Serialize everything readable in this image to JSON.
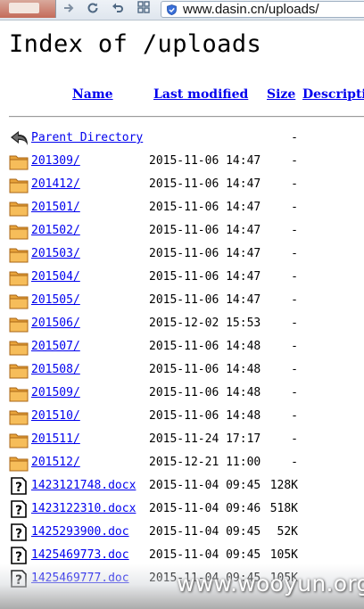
{
  "browser": {
    "url": "www.dasin.cn/uploads/",
    "icons": [
      "forward-icon",
      "refresh-icon",
      "undo-icon",
      "windows-icon",
      "security-shield-icon"
    ]
  },
  "page": {
    "title": "Index of /uploads",
    "columns": {
      "name": "Name",
      "last_modified": "Last modified",
      "size": "Size",
      "description": "Description"
    },
    "entries": [
      {
        "name": "Parent Directory",
        "date": "",
        "size": "-",
        "icon": "back-arrow-icon"
      },
      {
        "name": "201309/",
        "date": "2015-11-06 14:47",
        "size": "-",
        "icon": "folder-icon"
      },
      {
        "name": "201412/",
        "date": "2015-11-06 14:47",
        "size": "-",
        "icon": "folder-icon"
      },
      {
        "name": "201501/",
        "date": "2015-11-06 14:47",
        "size": "-",
        "icon": "folder-icon"
      },
      {
        "name": "201502/",
        "date": "2015-11-06 14:47",
        "size": "-",
        "icon": "folder-icon"
      },
      {
        "name": "201503/",
        "date": "2015-11-06 14:47",
        "size": "-",
        "icon": "folder-icon"
      },
      {
        "name": "201504/",
        "date": "2015-11-06 14:47",
        "size": "-",
        "icon": "folder-icon"
      },
      {
        "name": "201505/",
        "date": "2015-11-06 14:47",
        "size": "-",
        "icon": "folder-icon"
      },
      {
        "name": "201506/",
        "date": "2015-12-02 15:53",
        "size": "-",
        "icon": "folder-icon"
      },
      {
        "name": "201507/",
        "date": "2015-11-06 14:48",
        "size": "-",
        "icon": "folder-icon"
      },
      {
        "name": "201508/",
        "date": "2015-11-06 14:48",
        "size": "-",
        "icon": "folder-icon"
      },
      {
        "name": "201509/",
        "date": "2015-11-06 14:48",
        "size": "-",
        "icon": "folder-icon"
      },
      {
        "name": "201510/",
        "date": "2015-11-06 14:48",
        "size": "-",
        "icon": "folder-icon"
      },
      {
        "name": "201511/",
        "date": "2015-11-24 17:17",
        "size": "-",
        "icon": "folder-icon"
      },
      {
        "name": "201512/",
        "date": "2015-12-21 11:00",
        "size": "-",
        "icon": "folder-icon"
      },
      {
        "name": "1423121748.docx",
        "date": "2015-11-04 09:45",
        "size": "128K",
        "icon": "unknown-file-icon"
      },
      {
        "name": "1423122310.docx",
        "date": "2015-11-04 09:46",
        "size": "518K",
        "icon": "unknown-file-icon"
      },
      {
        "name": "1425293900.doc",
        "date": "2015-11-04 09:45",
        "size": "52K",
        "icon": "unknown-file-icon"
      },
      {
        "name": "1425469773.doc",
        "date": "2015-11-04 09:45",
        "size": "105K",
        "icon": "unknown-file-icon"
      },
      {
        "name": "1425469777.doc",
        "date": "2015-11-04 09:45",
        "size": "105K",
        "icon": "unknown-file-icon"
      }
    ]
  },
  "watermark": {
    "text": "www.wooyun.org"
  },
  "colors": {
    "link": "#0000ee",
    "folder": "#e8a33c",
    "folder_dark": "#b8741c"
  }
}
